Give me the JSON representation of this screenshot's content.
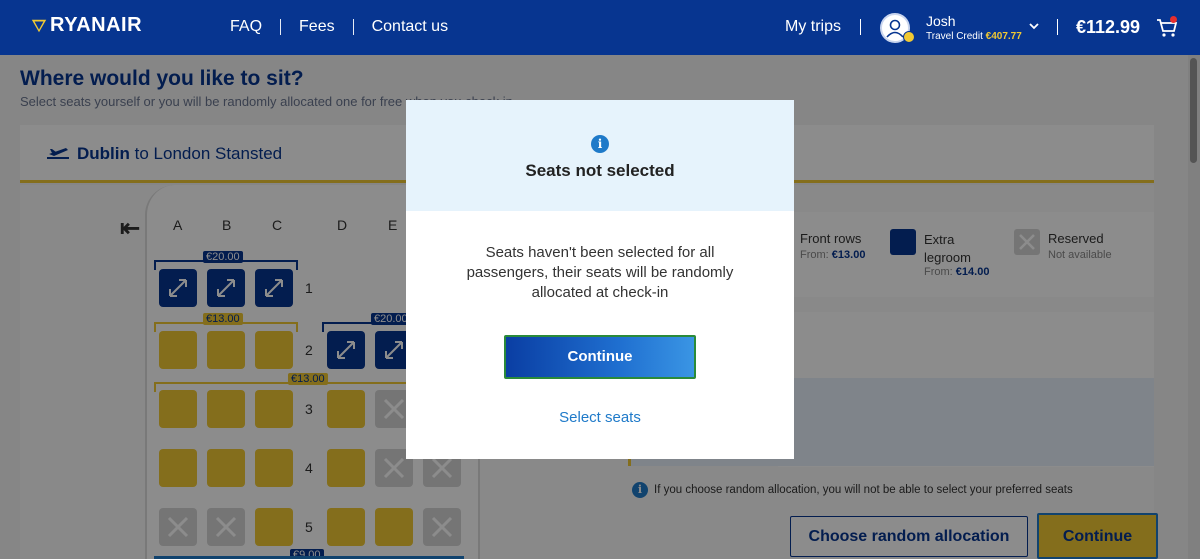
{
  "header": {
    "logo_text": "RYANAIR",
    "nav": [
      "FAQ",
      "Fees",
      "Contact us"
    ],
    "my_trips": "My trips",
    "user_name": "Josh",
    "travel_credit_label": "Travel Credit",
    "travel_credit_value": "€407.77",
    "basket_total": "€112.99"
  },
  "page": {
    "title": "Where would you like to sit?",
    "subtitle": "Select seats yourself or you will be randomly allocated one for free when you check in",
    "flight_from": "Dublin",
    "flight_connector": "to",
    "flight_to": "London Stansted"
  },
  "seat_map": {
    "columns": [
      "A",
      "B",
      "C",
      "D",
      "E"
    ],
    "rows": [
      "1",
      "2",
      "3",
      "4",
      "5"
    ],
    "price_tags": [
      "€20.00",
      "€13.00",
      "€20.00",
      "€13.00",
      "€9.00"
    ]
  },
  "legend": [
    {
      "title": "Front rows",
      "price_label": "From:",
      "price": "€13.00"
    },
    {
      "title": "Extra legroom",
      "price_label": "From:",
      "price": "€14.00"
    },
    {
      "title": "Reserved",
      "price_label": "Not available",
      "price": ""
    }
  ],
  "footer": {
    "random_note": "If you choose random allocation, you will not be able to select your preferred seats",
    "random_button": "Choose random allocation",
    "continue_button": "Continue"
  },
  "modal": {
    "title": "Seats not selected",
    "body": "Seats haven't been selected for all passengers, their seats will be randomly allocated at check-in",
    "continue_button": "Continue",
    "select_link": "Select seats"
  },
  "colors": {
    "brand_blue": "#073590",
    "brand_yellow": "#f1c933",
    "link_blue": "#1f7ac9"
  }
}
